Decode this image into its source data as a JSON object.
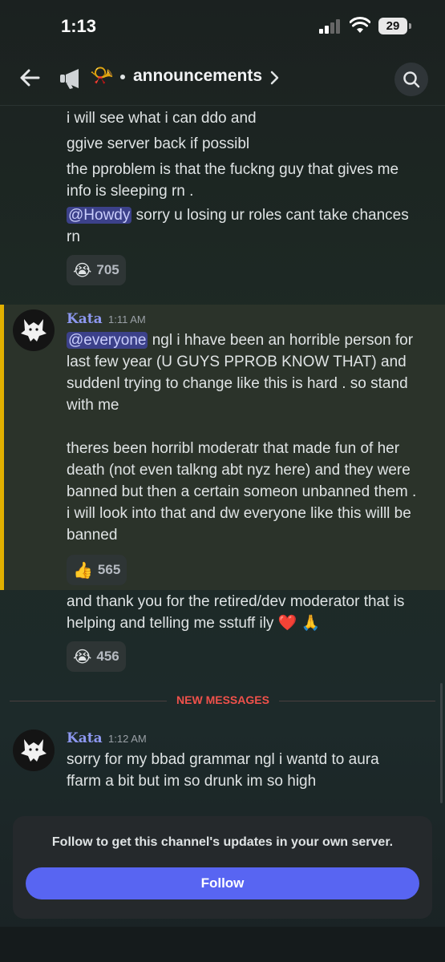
{
  "status": {
    "time": "1:13",
    "battery": "29"
  },
  "header": {
    "horn_emoji": "📯",
    "channel": "announcements"
  },
  "messages": {
    "prev": {
      "lines": [
        "i will see what i can ddo and",
        "ggive server back if possibl",
        "the pproblem is that the fuckng guy that gives me",
        "info is sleeping rn ."
      ],
      "mention": "@Howdy",
      "mention_rest": " sorry u losing ur roles cant take chances",
      "mention_line2": "rn",
      "reaction_emoji": "😭",
      "reaction_count": "705"
    },
    "kata1": {
      "username": "Kata",
      "time": "1:11 AM",
      "mention": "@everyone",
      "line1_rest": " ngl i hhave been an horrible person for",
      "lines_a": [
        "last few year (U GUYS PPROB KNOW THAT) and",
        "suddenl trying to change like this is hard . so stand",
        "with me"
      ],
      "lines_b": [
        "theres been horribl moderatr that made fun of her",
        "death (not even talkng abt nyz here) and they were",
        "banned but then a certain someon unbanned them .",
        "i will look into that and dw everyone like this willl be",
        "banned"
      ],
      "reaction_emoji": "👍",
      "reaction_count": "565"
    },
    "kata1_follow": {
      "line1": "and thank you for the retired/dev moderator that is",
      "line2": "helping and telling me sstuff ily ❤️ 🙏",
      "reaction_emoji": "😭",
      "reaction_count": "456"
    },
    "new_messages_label": "NEW MESSAGES",
    "kata2": {
      "username": "Kata",
      "time": "1:12 AM",
      "line1": "sorry for my bbad grammar ngl i wantd to aura",
      "line2": "ffarm a bit but im so drunk im so high"
    }
  },
  "follow": {
    "prompt": "Follow to get this channel's updates in your own server.",
    "button": "Follow"
  },
  "icons": [
    "back-arrow-icon",
    "megaphone-icon",
    "chevron-right-icon",
    "search-icon",
    "avatar-wolf-icon"
  ],
  "colors": {
    "accent": "#5865f2",
    "mention_bg": "#3c418a",
    "highlight_bar": "#e1b000",
    "new_messages": "#f0514b"
  }
}
